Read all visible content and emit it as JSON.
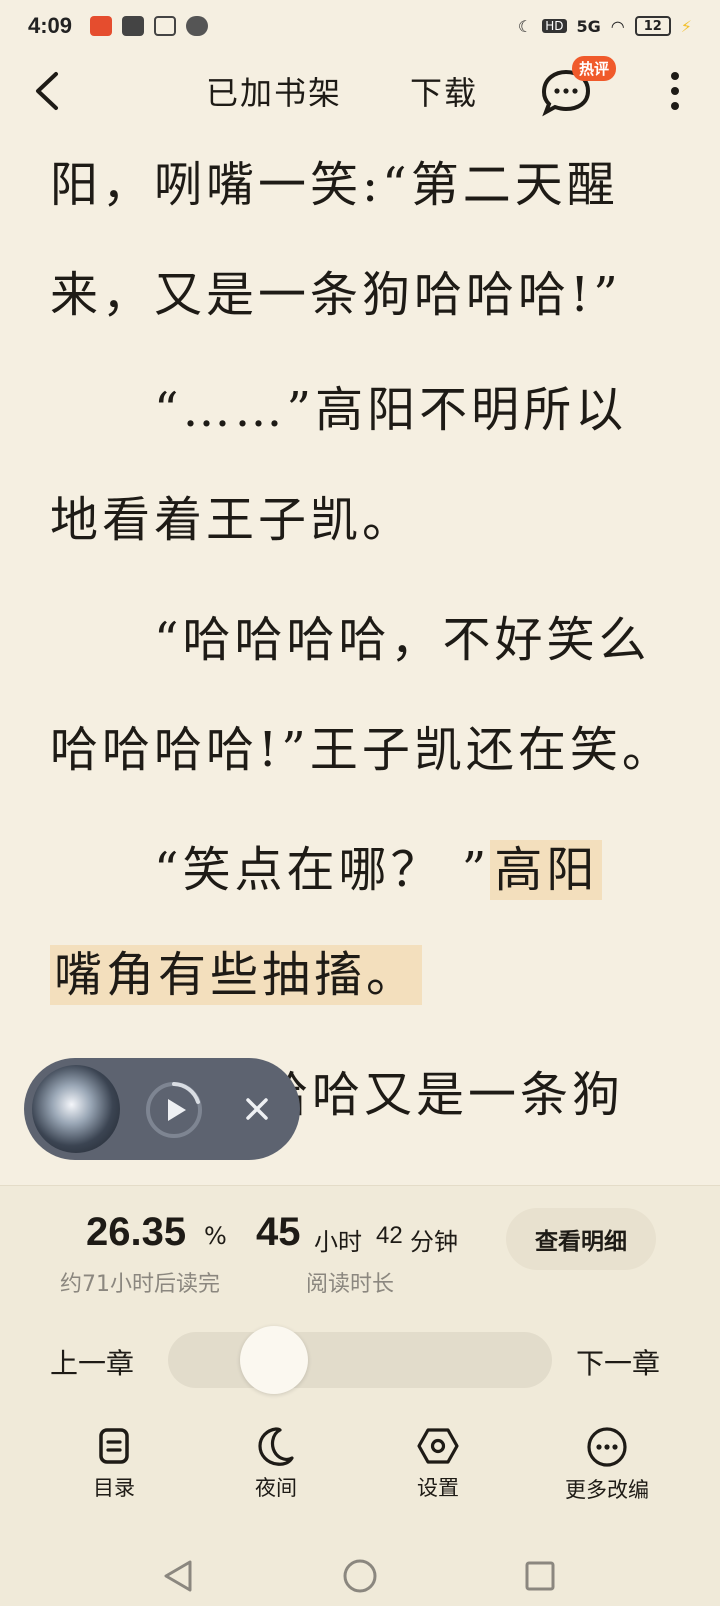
{
  "status_bar": {
    "time": "4:09",
    "hd_label": "HD",
    "signal_label": "5G",
    "battery_level": "12"
  },
  "toolbar": {
    "shelf_label": "已加书架",
    "download_label": "下载",
    "hot_badge": "热评"
  },
  "reader": {
    "lines": [
      "阳，咧嘴一笑:“第二天醒",
      "来，又是一条狗哈哈哈!”",
      "　　“……”高阳不明所以",
      "地看着王子凯。",
      "　　“哈哈哈哈，不好笑么",
      "哈哈哈哈!”王子凯还在笑。",
      "　　“笑点在哪？ ”",
      "高阳",
      "嘴角有些抽搐。",
      "哈哈又是一条狗"
    ]
  },
  "progress": {
    "percent_value": "26.35",
    "percent_unit": "%",
    "finish_hint": "约71小时后读完",
    "hours_value": "45",
    "hours_unit": "小时",
    "minutes_value": "42",
    "minutes_unit": "分钟",
    "duration_label": "阅读时长",
    "detail_button": "查看明细",
    "slider_fraction": 0.2635
  },
  "chapter_nav": {
    "prev_label": "上一章",
    "next_label": "下一章"
  },
  "bottom_nav": {
    "items": [
      {
        "label": "目录",
        "icon": "catalog-icon"
      },
      {
        "label": "夜间",
        "icon": "moon-icon"
      },
      {
        "label": "设置",
        "icon": "settings-icon"
      },
      {
        "label": "更多改编",
        "icon": "more-dots-icon"
      }
    ]
  },
  "colors": {
    "background": "#f5efe1",
    "highlight": "#f3dfbd",
    "badge": "#f05a2b"
  }
}
